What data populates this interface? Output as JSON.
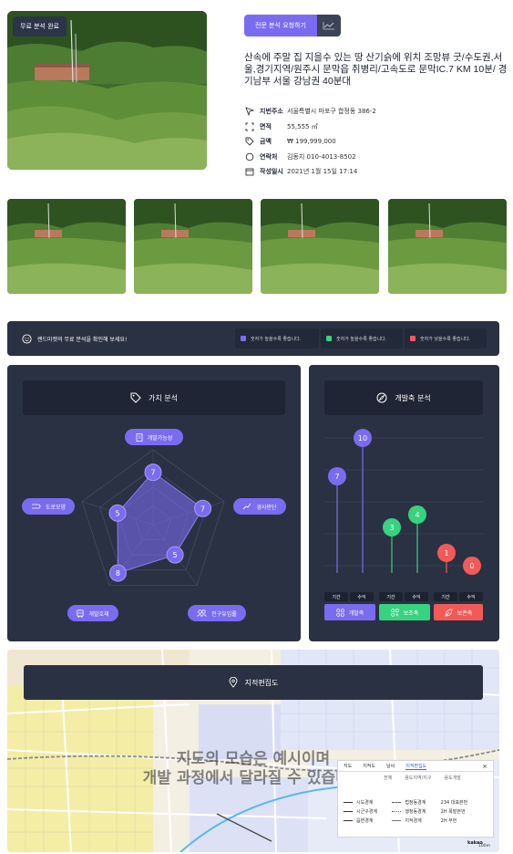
{
  "hero": {
    "badge": "무료 분석 완료"
  },
  "actions": {
    "request_label": "전문 분석 요청하기",
    "chart_icon": "chart-line-icon"
  },
  "listing": {
    "title": "산속에 주말 집 지을수 있는 땅 산기슭에 위치 조망뷰 굿/수도권,서울,경기지역/원주시 문막읍 취병리/고속도로 문막IC.7 KM 10분/ 경기남부 서울 강남권 40분대",
    "info": [
      {
        "icon": "location-arrow-icon",
        "label": "지번주소",
        "value": "서울특별시 마포구 합정동 386-2"
      },
      {
        "icon": "area-icon",
        "label": "면적",
        "value": "55,555 ㎡"
      },
      {
        "icon": "tag-icon",
        "label": "금액",
        "value": "₩ 199,999,000"
      },
      {
        "icon": "chat-bubble-icon",
        "label": "연락처",
        "value": "김동지   010-4013-8502"
      },
      {
        "icon": "calendar-icon",
        "label": "작성일시",
        "value": "2021년 1월 15일  17:14"
      }
    ]
  },
  "notice": {
    "text": "랜드마켓의 무료 분석을 확인해 보세요!",
    "legend": [
      {
        "color": "#7a6cf0",
        "text": "숫자가 높을수록 좋습니다."
      },
      {
        "color": "#37d37e",
        "text": "숫자가 높을수록 좋습니다."
      },
      {
        "color": "#f25a5a",
        "text": "숫자가 낮을수록 좋습니다."
      }
    ]
  },
  "value_panel": {
    "title": "가치 분석",
    "axes": [
      "개발가능성",
      "경사판단",
      "인구유입률",
      "개발호재",
      "도로모양"
    ],
    "values": [
      7,
      7,
      5,
      8,
      5
    ],
    "max": 10
  },
  "dev_panel": {
    "title": "개발축 분석",
    "bars": [
      {
        "value": 7,
        "color": "#7a6cf0"
      },
      {
        "value": 10,
        "color": "#7a6cf0"
      },
      {
        "value": 3,
        "color": "#37d37e"
      },
      {
        "value": 4,
        "color": "#37d37e"
      },
      {
        "value": 1,
        "color": "#f25a5a"
      },
      {
        "value": 0,
        "color": "#f25a5a"
      }
    ],
    "categories": [
      "기간",
      "수익",
      "기간",
      "수익",
      "기간",
      "수익"
    ],
    "buttons": [
      {
        "label": "개발축",
        "color": "#7a6cf0"
      },
      {
        "label": "보조축",
        "color": "#37d37e"
      },
      {
        "label": "보존축",
        "color": "#f25a5a"
      }
    ],
    "max": 10
  },
  "map": {
    "title": "지적편집도",
    "overlay_line1": "지도의 모습은 예시이며",
    "overlay_line2": "개발 과정에서 달라질 수 있습니다",
    "panel": {
      "tabs": [
        "지도",
        "지적도",
        "날씨",
        "지적편집도"
      ],
      "active_tab": "지적편집도",
      "sub": [
        "전체",
        "용도지역/지구",
        "용도개발"
      ],
      "legend": [
        [
          "시도경계",
          "법정동경계",
          "234 대표본번"
        ],
        [
          "시군구경계",
          "행정동경계",
          "2H 폭발본번"
        ],
        [
          "읍면경계",
          "지적경계",
          "2H 부번"
        ]
      ]
    },
    "logo": "kakao",
    "scale": "100m"
  }
}
